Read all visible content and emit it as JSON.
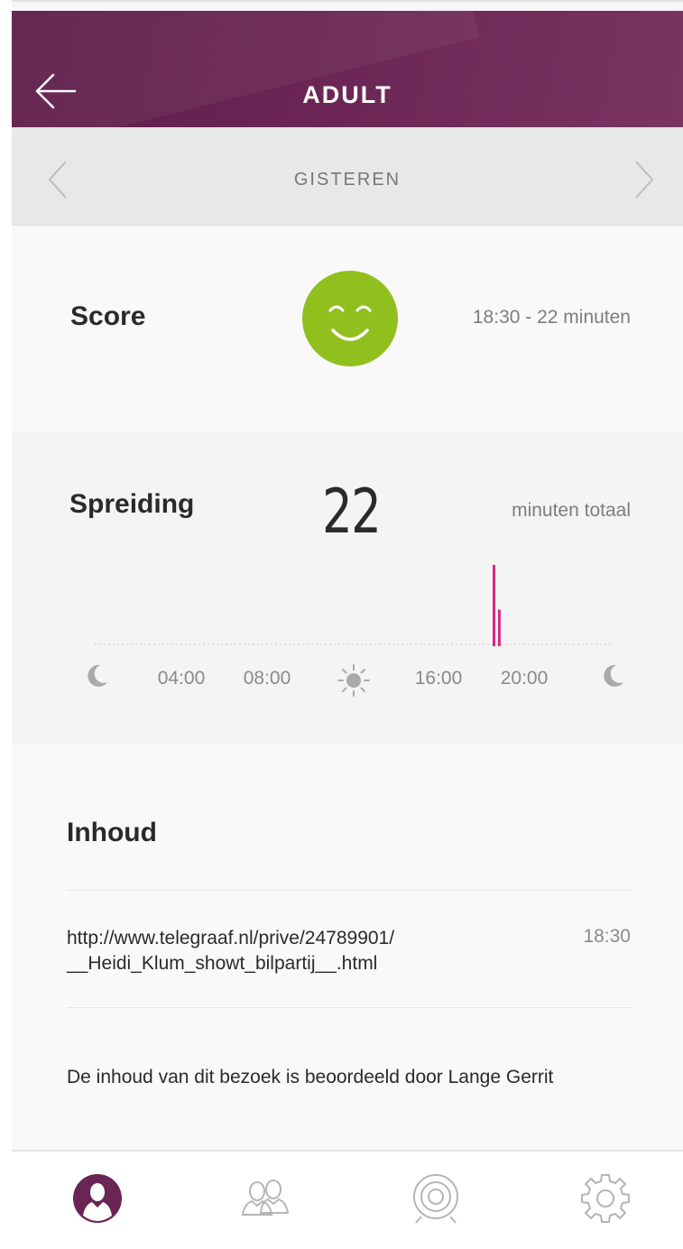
{
  "header": {
    "title": "ADULT",
    "back_icon": "arrow-left-icon",
    "background": "#6a2554"
  },
  "datebar": {
    "label": "GISTEREN",
    "prev_icon": "chevron-left-icon",
    "next_icon": "chevron-right-icon"
  },
  "score": {
    "label": "Score",
    "face_icon": "smiley-face-icon",
    "face_color": "#91c01e",
    "time_range": "18:30 - 22 minuten"
  },
  "spreiding": {
    "label": "Spreiding",
    "total": "22",
    "unit": "minuten totaal",
    "axis": {
      "start_icon": "moon-icon",
      "ticks": [
        "04:00",
        "08:00",
        "16:00",
        "20:00"
      ],
      "noon_icon": "sun-icon",
      "end_icon": "moon-icon"
    },
    "bar_color": "#d9268a"
  },
  "chart_data": {
    "type": "bar",
    "x_unit": "hour of day",
    "xlim": [
      0,
      24
    ],
    "bars": [
      {
        "hour": 18.5,
        "relative_height": 1.0
      },
      {
        "hour": 18.75,
        "relative_height": 0.45
      }
    ],
    "grid": false
  },
  "inhoud": {
    "label": "Inhoud",
    "items": [
      {
        "url_line1": "http://www.telegraaf.nl/prive/24789901/",
        "url_line2": "__Heidi_Klum_showt_bilpartij__.html",
        "time": "18:30"
      }
    ],
    "assessment": "De inhoud van dit bezoek is beoordeeld door Lange Gerrit"
  },
  "tabbar": {
    "tabs": [
      {
        "icon": "profile-icon",
        "active": true
      },
      {
        "icon": "users-icon",
        "active": false
      },
      {
        "icon": "target-icon",
        "active": false
      },
      {
        "icon": "gear-icon",
        "active": false
      }
    ],
    "active_color": "#6a2554",
    "inactive_color": "#b5b5b5"
  }
}
